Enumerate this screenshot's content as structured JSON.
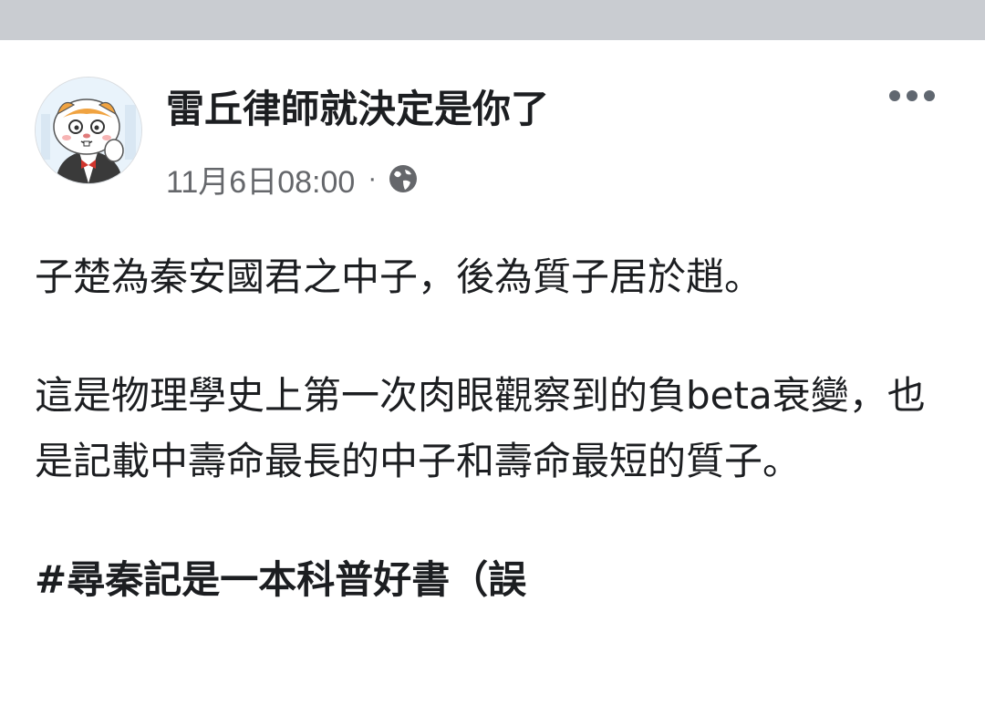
{
  "post": {
    "author_name": "雷丘律師就決定是你了",
    "timestamp": "11月6日08:00",
    "separator": "·",
    "privacy_icon": "globe-icon",
    "more_icon": "more-horizontal-icon",
    "paragraphs": [
      "子楚為秦安國君之中子，後為質子居於趙。",
      "這是物理學史上第一次肉眼觀察到的負beta衰變，也是記載中壽命最長的中子和壽命最短的質子。"
    ],
    "hashtag": "#尋秦記是一本科普好書（誤"
  },
  "colors": {
    "top_strip": "#c9ccd1",
    "text_primary": "#1c1e21",
    "text_secondary": "#65676b"
  }
}
